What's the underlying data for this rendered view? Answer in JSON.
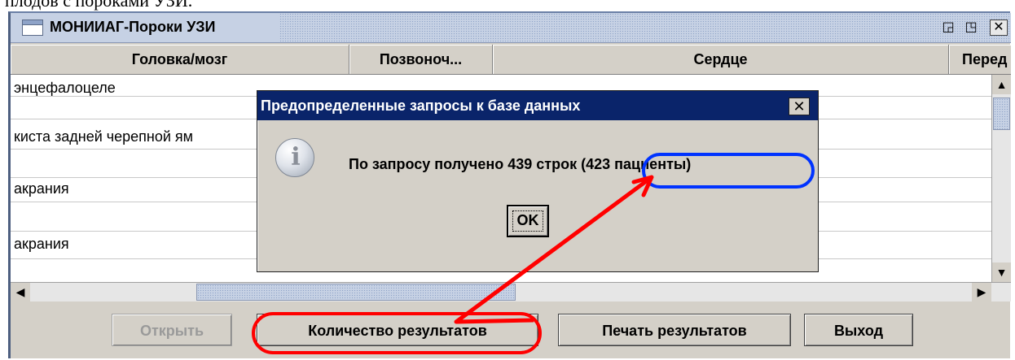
{
  "document": {
    "caption_text": "плодов с пороками УЗИ."
  },
  "frame": {
    "title": "МОНИИАГ-Пороки УЗИ",
    "controls": {
      "restore": "◲",
      "maximize": "◳",
      "close": "✕"
    }
  },
  "table": {
    "columns": [
      "Головка/мозг",
      "Позвоноч...",
      "Сердце",
      "Перед"
    ],
    "rows": [
      "энцефалоцеле",
      "",
      "киста задней черепной ям",
      "",
      "акрания",
      "",
      "акрания"
    ]
  },
  "dialog": {
    "title": "Предопределенные запросы к базе данных",
    "close": "✕",
    "message": "По запросу получено 439 строк",
    "highlight": "(423 пациенты)",
    "ok": "OK"
  },
  "buttons": {
    "open": "Открыть",
    "count": "Количество результатов",
    "print": "Печать результатов",
    "exit": "Выход"
  },
  "colors": {
    "dialog_title_bg": "#0a246a",
    "annotation_red": "#ff0000",
    "annotation_blue": "#0033ff"
  }
}
